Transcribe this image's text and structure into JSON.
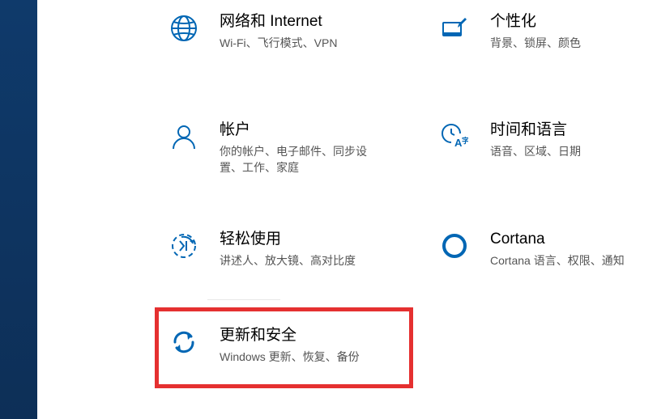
{
  "categories": {
    "network": {
      "title": "网络和 Internet",
      "sub": "Wi-Fi、飞行模式、VPN"
    },
    "personalize": {
      "title": "个性化",
      "sub": "背景、锁屏、颜色"
    },
    "accounts": {
      "title": "帐户",
      "sub": "你的帐户、电子邮件、同步设置、工作、家庭"
    },
    "timelang": {
      "title": "时间和语言",
      "sub": "语音、区域、日期"
    },
    "ease": {
      "title": "轻松使用",
      "sub": "讲述人、放大镜、高对比度"
    },
    "cortana": {
      "title": "Cortana",
      "sub": "Cortana 语言、权限、通知"
    },
    "update": {
      "title": "更新和安全",
      "sub": "Windows 更新、恢复、备份"
    }
  },
  "colors": {
    "icon": "#0066b4",
    "highlight": "#e53030"
  }
}
